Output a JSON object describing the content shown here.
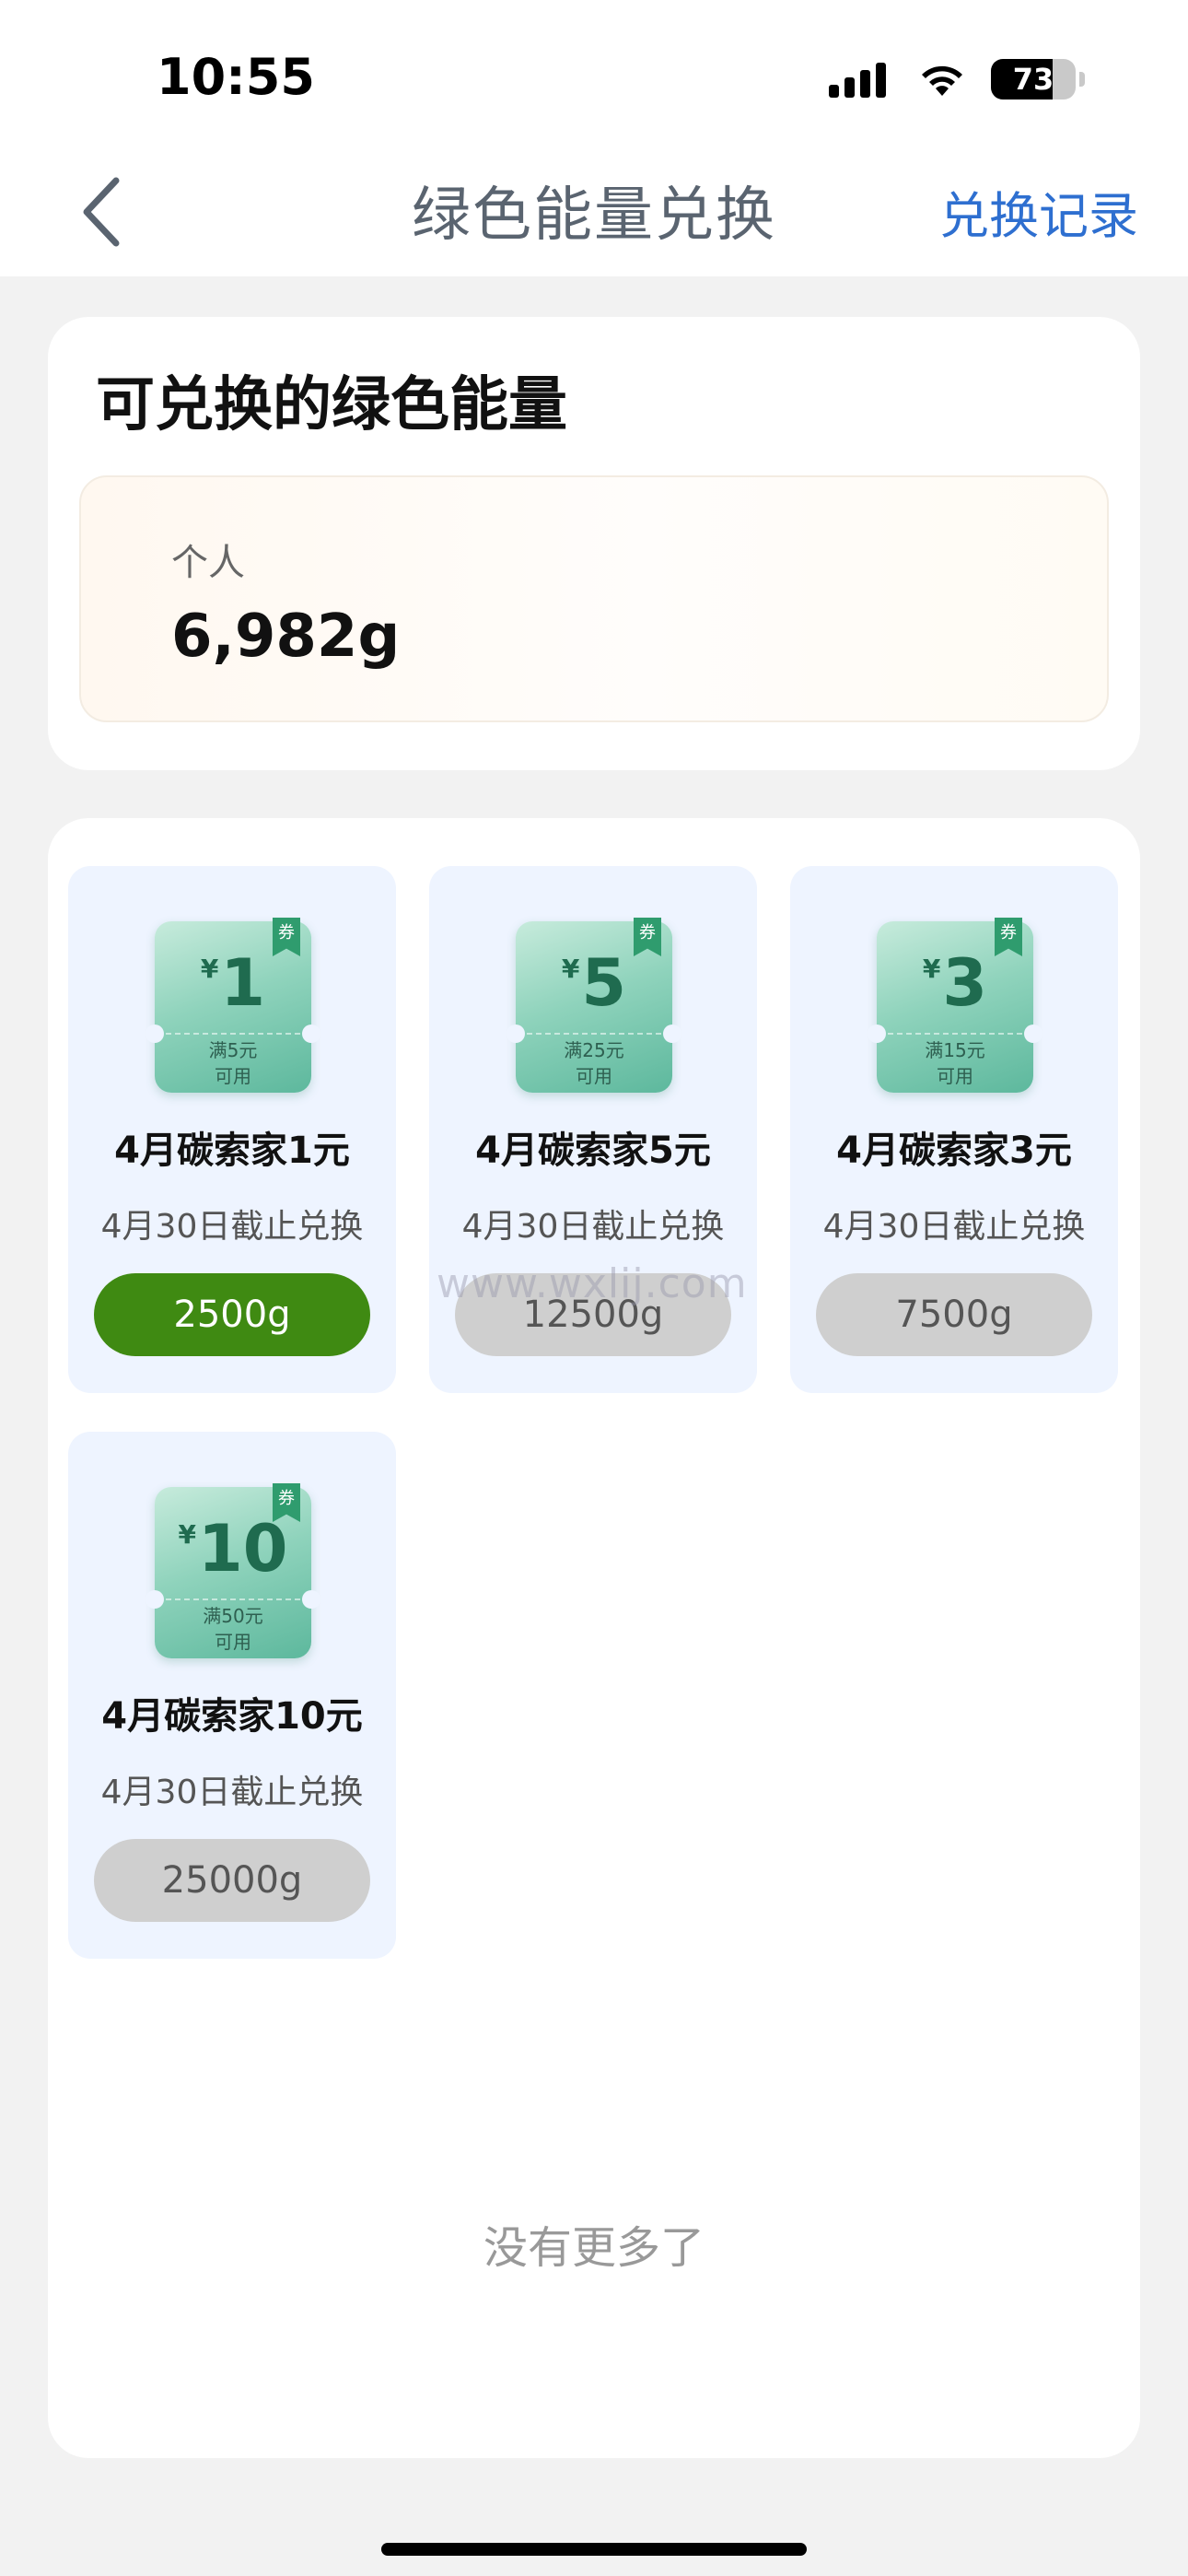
{
  "status_bar": {
    "time": "10:55",
    "battery_level": "73",
    "battery_fraction": 0.73,
    "icons": [
      "signal-icon",
      "wifi-icon",
      "battery-icon"
    ]
  },
  "nav": {
    "back_icon": "chevron-left-icon",
    "title": "绿色能量兑换",
    "history_link": "兑换记录"
  },
  "energy": {
    "title": "可兑换的绿色能量",
    "label": "个人",
    "value": "6,982g"
  },
  "coupons": [
    {
      "currency": "¥",
      "amount": "1",
      "condition_line1": "满5元",
      "condition_line2": "可用",
      "tag": "券",
      "name": "4月碳索家1元",
      "deadline": "4月30日截止兑换",
      "cost": "2500g",
      "enabled": true
    },
    {
      "currency": "¥",
      "amount": "5",
      "condition_line1": "满25元",
      "condition_line2": "可用",
      "tag": "券",
      "name": "4月碳索家5元",
      "deadline": "4月30日截止兑换",
      "cost": "12500g",
      "enabled": false
    },
    {
      "currency": "¥",
      "amount": "3",
      "condition_line1": "满15元",
      "condition_line2": "可用",
      "tag": "券",
      "name": "4月碳索家3元",
      "deadline": "4月30日截止兑换",
      "cost": "7500g",
      "enabled": false
    },
    {
      "currency": "¥",
      "amount": "10",
      "condition_line1": "满50元",
      "condition_line2": "可用",
      "tag": "券",
      "name": "4月碳索家10元",
      "deadline": "4月30日截止兑换",
      "cost": "25000g",
      "enabled": false
    }
  ],
  "footer": {
    "no_more": "没有更多了"
  },
  "watermark": "www.wxlij.com",
  "colors": {
    "accent_green": "#3f8a12",
    "disabled_gray": "#cfcfcf",
    "link_blue": "#2e6fd0",
    "card_bg": "#eef4ff"
  }
}
